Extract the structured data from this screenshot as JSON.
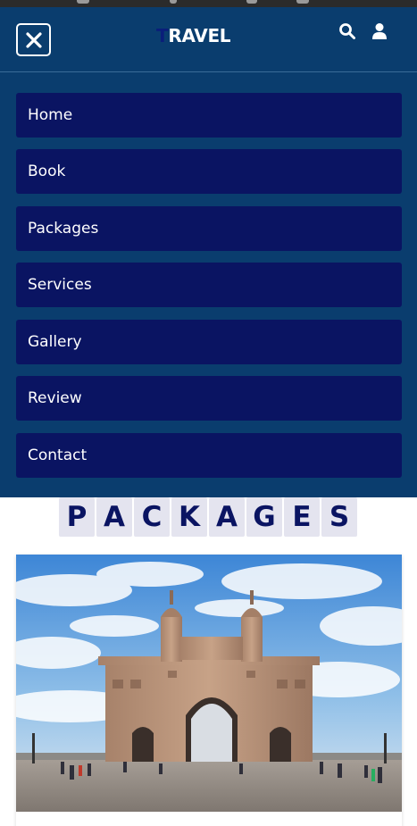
{
  "header": {
    "logo_first_letter": "T",
    "logo_rest": "RAVEL"
  },
  "nav": {
    "items": [
      {
        "label": "Home"
      },
      {
        "label": "Book"
      },
      {
        "label": "Packages"
      },
      {
        "label": "Services"
      },
      {
        "label": "Gallery"
      },
      {
        "label": "Review"
      },
      {
        "label": "Contact"
      }
    ]
  },
  "packages": {
    "heading_letters": [
      "P",
      "A",
      "C",
      "K",
      "A",
      "G",
      "E",
      "S"
    ]
  },
  "colors": {
    "header_bg": "#0a3d6e",
    "nav_item_bg": "#0a1462",
    "heading_letter_bg": "#e4e4ef",
    "heading_letter_fg": "#0a1462"
  },
  "icons": {
    "close": "close-icon",
    "search": "search-icon",
    "user": "user-icon"
  }
}
